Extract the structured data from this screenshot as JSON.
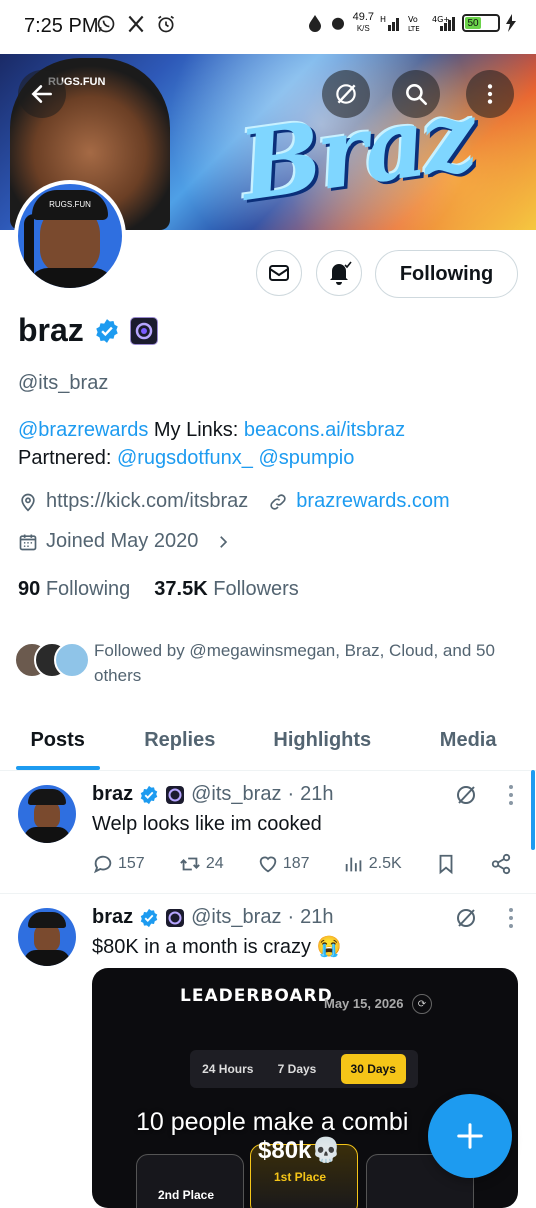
{
  "status_bar": {
    "time": "7:25 PM",
    "left_icons": [
      "whatsapp-icon",
      "x-icon",
      "alarm-icon"
    ],
    "net_speed_value": "49.7",
    "net_speed_unit": "K/S",
    "battery": "50"
  },
  "banner": {
    "text": "Braz",
    "hat_text": "RUGS.FUN"
  },
  "profile": {
    "display_name": "braz",
    "handle": "@its_braz",
    "bio_line1_mention": "@brazrewards",
    "bio_line1_text": " My Links: ",
    "bio_line1_link": "beacons.ai/itsbraz",
    "bio_line2_text": "Partnered: ",
    "bio_line2_mention1": "@rugsdotfunx_",
    "bio_line2_mention2": "@spumpio",
    "website1": "https://kick.com/itsbraz",
    "website2": "brazrewards.com",
    "joined": "Joined May 2020",
    "following_count": "90",
    "following_label": "Following",
    "followers_count": "37.5K",
    "followers_label": "Followers",
    "followed_by": "Followed by @megawinsmegan, Braz, Cloud, and 50 others"
  },
  "actions_bar": {
    "following_button": "Following"
  },
  "tabs": [
    {
      "label": "Posts",
      "active": true
    },
    {
      "label": "Replies",
      "active": false
    },
    {
      "label": "Highlights",
      "active": false
    },
    {
      "label": "Media",
      "active": false
    }
  ],
  "posts": [
    {
      "name": "braz",
      "handle": "@its_braz",
      "time": "21h",
      "text": "Welp looks like im cooked",
      "replies": "157",
      "reposts": "24",
      "likes": "187",
      "views": "2.5K"
    },
    {
      "name": "braz",
      "handle": "@its_braz",
      "time": "21h",
      "text": "$80K in a month is crazy 😭",
      "media": {
        "title": "LEADERBOARD",
        "date": "May 15, 2026",
        "tabs": [
          "24 Hours",
          "7 Days",
          "30 Days"
        ],
        "selected_tab": "30 Days",
        "caption": "10 people make a combi",
        "amount": "$80k💀",
        "first_place": "1st Place",
        "second_place": "2nd Place"
      }
    }
  ],
  "colors": {
    "accent": "#1d9bf0",
    "text": "#0f1419",
    "muted": "#536471"
  }
}
